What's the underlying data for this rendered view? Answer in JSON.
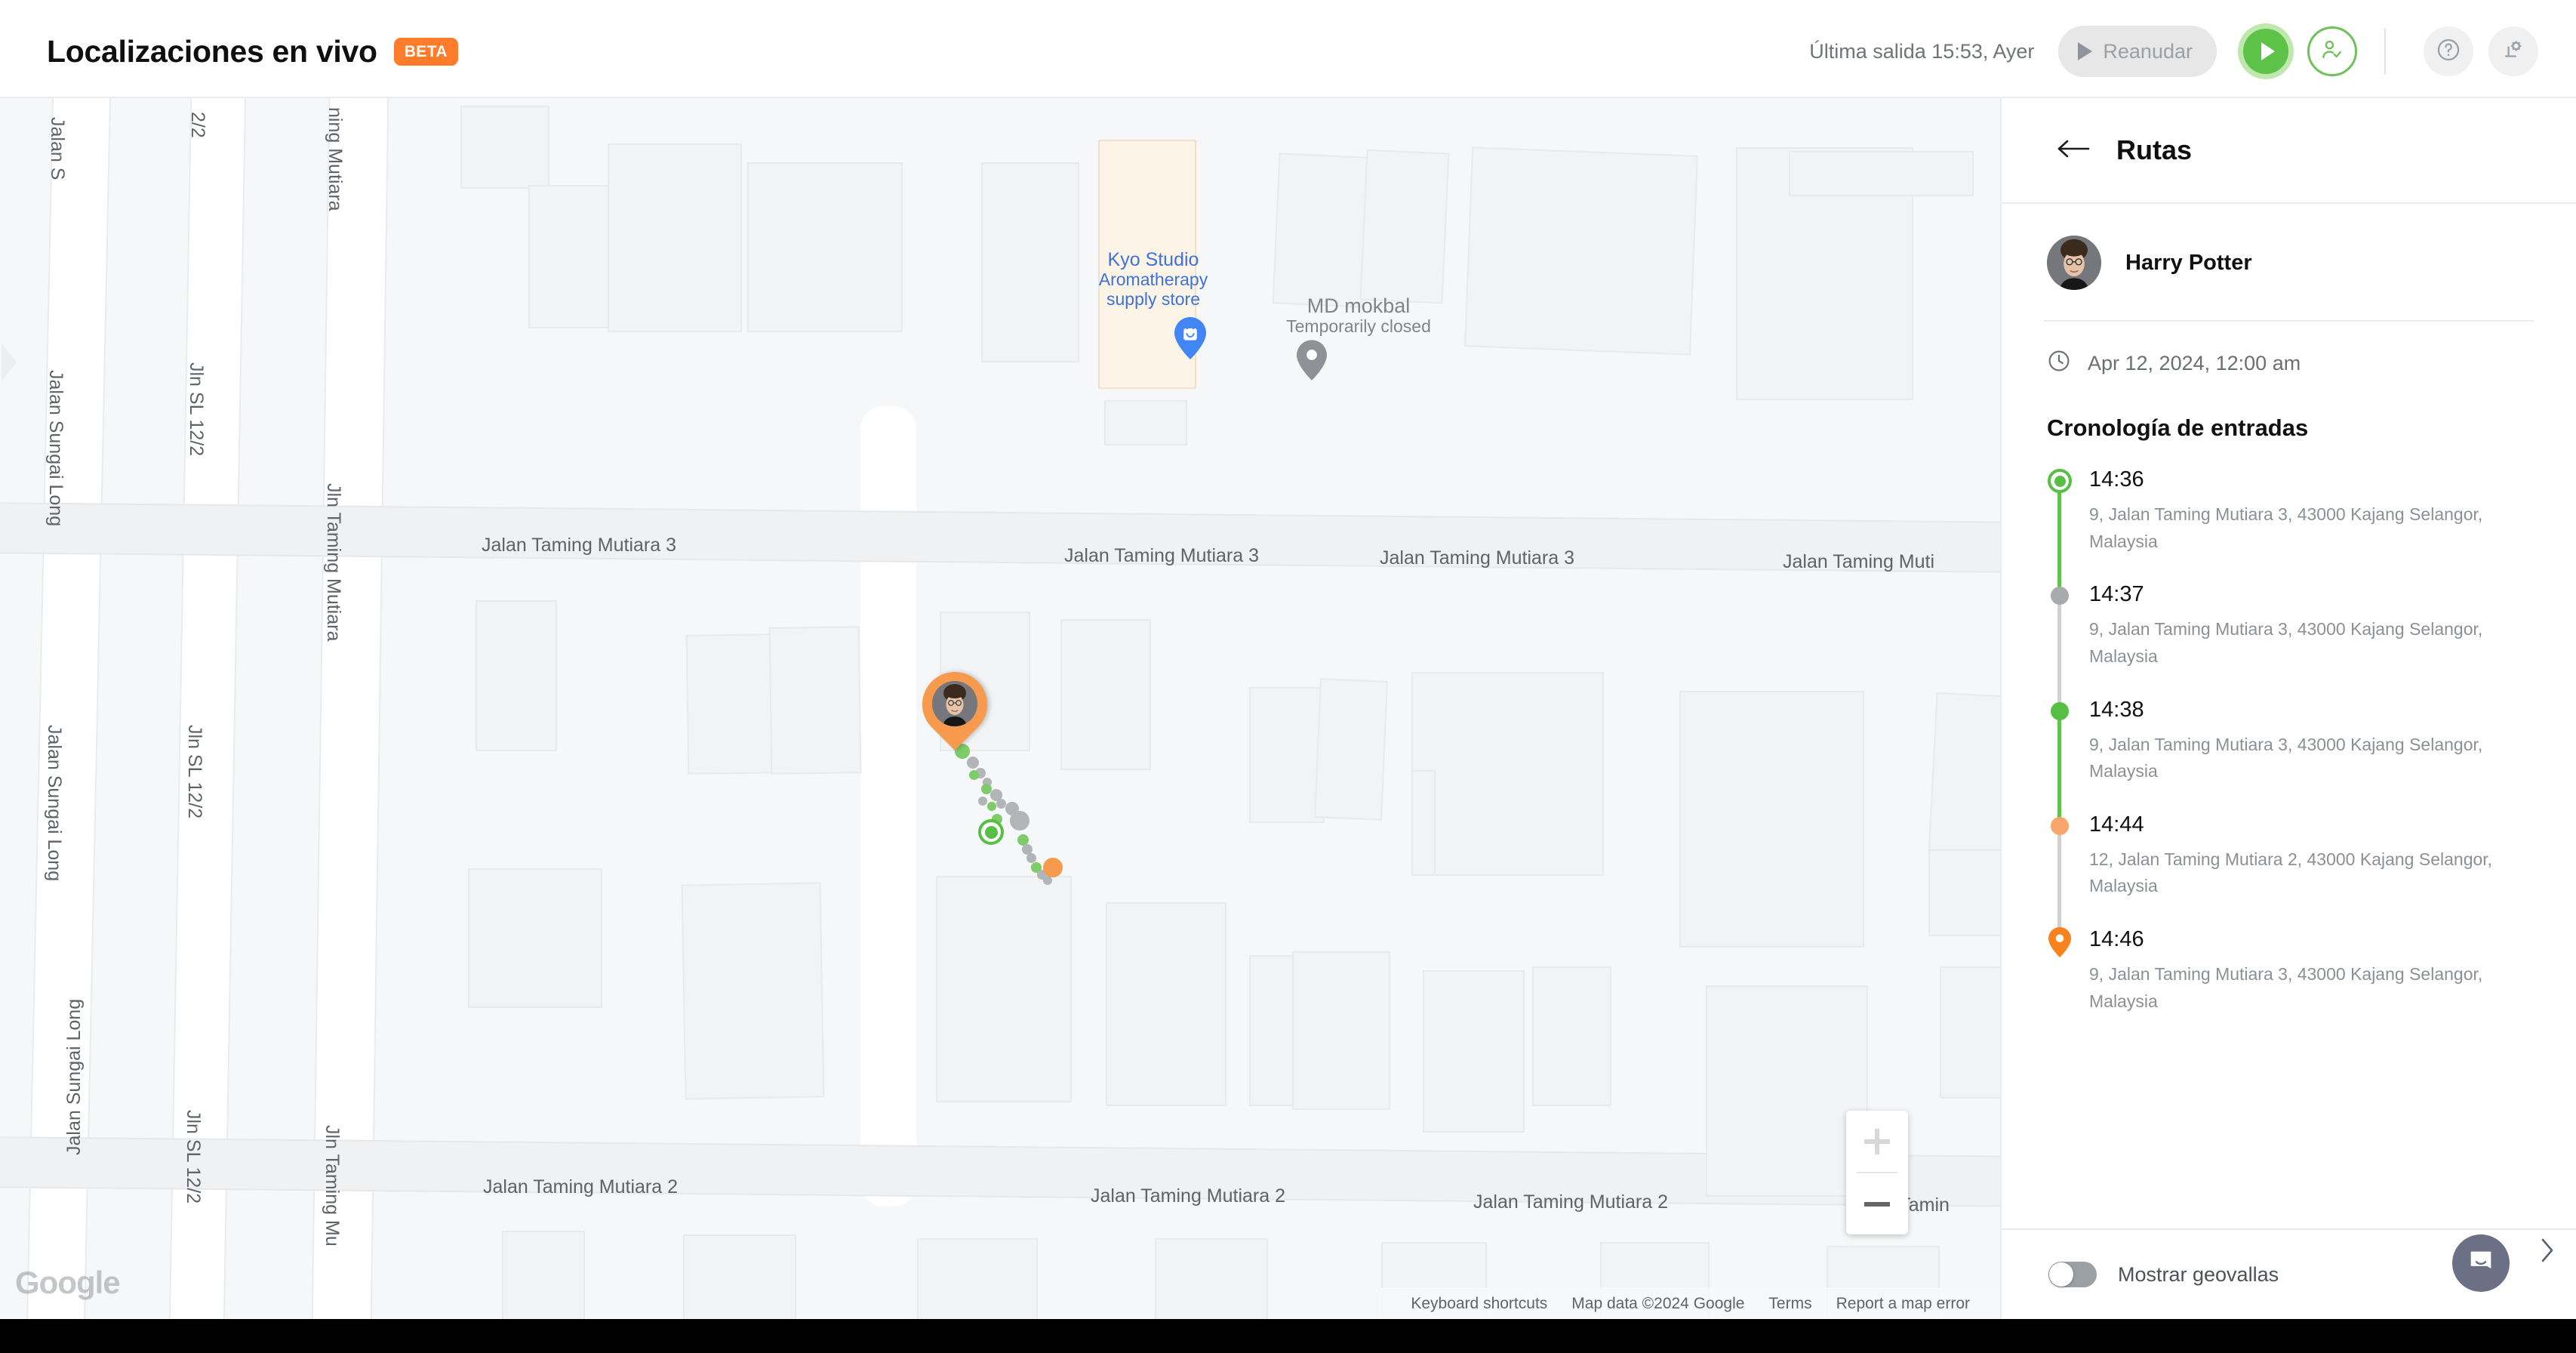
{
  "header": {
    "title": "Localizaciones en vivo",
    "badge": "BETA",
    "last_exit": "Última salida 15:53, Ayer",
    "resume_label": "Reanudar",
    "icons": {
      "play": "play-icon",
      "play_circle": "play-live-button",
      "person_check": "person-check-icon",
      "help": "help-icon",
      "settings": "plant-settings-icon"
    },
    "accent_orange": "#ff7c2b",
    "accent_green": "#5cc248"
  },
  "panel": {
    "title": "Rutas",
    "back_icon": "back-arrow-icon",
    "user_name": "Harry Potter",
    "clock_icon": "clock-icon",
    "date": "Apr 12, 2024, 12:00 am",
    "timeline_title": "Cronología de entradas",
    "entries": [
      {
        "time": "14:36",
        "address": "9, Jalan Taming Mutiara 3, 43000 Kajang Selangor, Malaysia",
        "marker": "ring",
        "color": "#57bf43",
        "line_color": "#62c24e"
      },
      {
        "time": "14:37",
        "address": "9, Jalan Taming Mutiara 3, 43000 Kajang Selangor, Malaysia",
        "marker": "dot",
        "color": "#a7abae",
        "line_color": "#cfd1d3"
      },
      {
        "time": "14:38",
        "address": "9, Jalan Taming Mutiara 3, 43000 Kajang Selangor, Malaysia",
        "marker": "dot",
        "color": "#57bf43",
        "line_color": "#62c24e"
      },
      {
        "time": "14:44",
        "address": "12, Jalan Taming Mutiara 2, 43000 Kajang Selangor, Malaysia",
        "marker": "dot",
        "color": "#f9a66c",
        "line_color": "#cfd1d3"
      },
      {
        "time": "14:46",
        "address": "9, Jalan Taming Mutiara 3, 43000 Kajang Selangor, Malaysia",
        "marker": "pin",
        "color": "#f7821e",
        "line_color": "transparent"
      }
    ],
    "geofence_toggle_label": "Mostrar geovallas",
    "geofence_toggle_on": false,
    "intercom_icon": "chat-bubble-icon",
    "collapse_icon": "chevron-right-icon"
  },
  "map": {
    "google_logo": "Google",
    "attribution": [
      "Keyboard shortcuts",
      "Map data ©2024 Google",
      "Terms",
      "Report a map error"
    ],
    "zoom_in_label": "+",
    "zoom_out_label": "−",
    "pois": [
      {
        "name": "Kyo Studio",
        "sub1": "Aromatherapy",
        "sub2": "supply store",
        "style": "blue",
        "icon": "shop-pin-icon"
      },
      {
        "name": "MD mokbal",
        "sub1": "Temporarily closed",
        "sub2": "",
        "style": "grey",
        "icon": "place-pin-icon"
      }
    ],
    "street_labels_h": [
      "Jalan Taming Mutiara 3",
      "Jalan Taming Mutiara 3",
      "Jalan Taming Mutiara 3",
      "Jalan Taming Muti",
      "Jalan Taming Mutiara 2",
      "Jalan Taming Mutiara 2",
      "Jalan Taming Mutiara 2",
      "Jalan Tamin"
    ],
    "street_labels_v": [
      "Jalan S",
      "Jalan Sungai Long",
      "Jalan Sungai Long",
      "Jalan Sungai Long",
      "2/2",
      "Jln SL 12/2",
      "Jln SL 12/2",
      "Jln SL 12/2",
      "ning Mutiara",
      "Jln Taming Mutiara",
      "Jln Taming Mu"
    ]
  }
}
